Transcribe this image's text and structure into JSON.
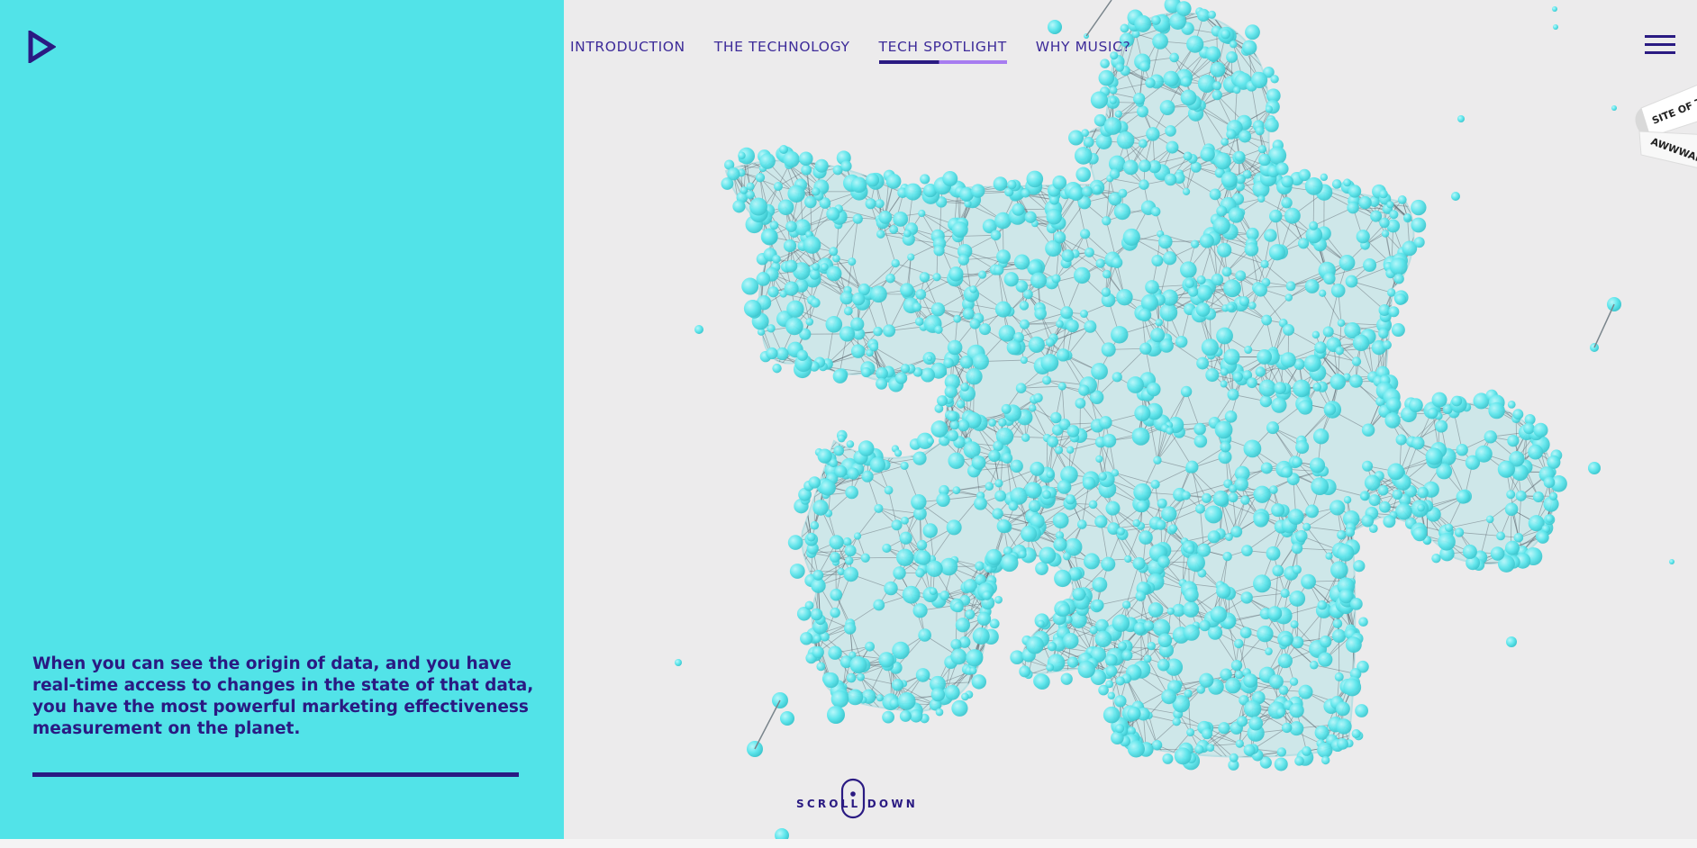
{
  "nav": {
    "items": [
      {
        "label": "INTRODUCTION",
        "active": false
      },
      {
        "label": "THE TECHNOLOGY",
        "active": false
      },
      {
        "label": "TECH SPOTLIGHT",
        "active": true
      },
      {
        "label": "WHY MUSIC?",
        "active": false
      }
    ]
  },
  "hero": {
    "headline": "When you can see the origin of data, and you have real-time access to changes in the state of that data, you have the most powerful marketing effectiveness measurement on the planet."
  },
  "scroll": {
    "label": "SCROLL DOWN"
  },
  "badge": {
    "line1": "SITE OF THE DAY",
    "line2": "AWWWARDS"
  },
  "colors": {
    "panel": "#52e3e8",
    "ink": "#2a1a82",
    "accent": "#a77cf0",
    "background": "#ecebec",
    "node": "#5fe6ec"
  },
  "icons": {
    "logo": "play-triangle-logo-icon",
    "menu": "hamburger-menu-icon",
    "scroll": "mouse-scroll-icon"
  }
}
